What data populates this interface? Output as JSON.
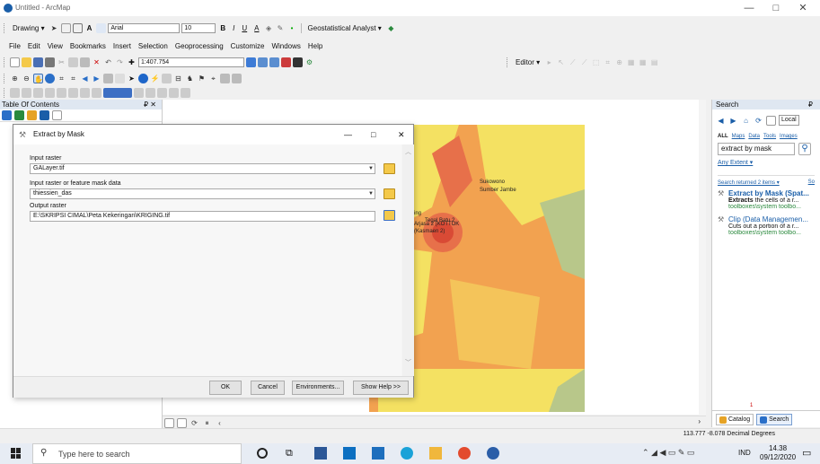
{
  "window": {
    "title": "Untitled - ArcMap",
    "minimize": "—",
    "maximize": "□",
    "close": "✕"
  },
  "drawing_toolbar": {
    "drawing_label": "Drawing ▾",
    "font_name": "Arial",
    "font_size": "10",
    "bold": "B",
    "italic": "I",
    "underline": "U",
    "letter_a": "A",
    "geostat_label": "Geostatistical Analyst ▾"
  },
  "menu": [
    "File",
    "Edit",
    "View",
    "Bookmarks",
    "Insert",
    "Selection",
    "Geoprocessing",
    "Customize",
    "Windows",
    "Help"
  ],
  "standard_toolbar": {
    "scale": "1:407.754",
    "editor_label": "Editor ▾"
  },
  "toc": {
    "title": "Table Of Contents",
    "pin": "₽ ✕"
  },
  "dialog": {
    "title": "Extract by Mask",
    "input_raster_label": "Input raster",
    "input_raster_value": "GALayer.tif",
    "mask_label": "Input raster or feature mask data",
    "mask_value": "thiessien_das",
    "output_label": "Output raster",
    "output_value": "E:\\SKRIPSI CIMAL\\Peta Kekeringan\\KRIGING.tif",
    "ok": "OK",
    "cancel": "Cancel",
    "environments": "Environments...",
    "show_help": "Show Help >>",
    "minimize": "—",
    "maximize": "□",
    "close": "✕"
  },
  "map": {
    "labels": [
      "Sukowono",
      "Sumber Jambe",
      "Tegal Batu 2",
      "Arjasa 2 (KOTTOK",
      "(Kasmaen 2)",
      "ring"
    ]
  },
  "search_pane": {
    "title": "Search",
    "pin": "₽",
    "local_label": "Local",
    "filters": [
      "ALL",
      "Maps",
      "Data",
      "Tools",
      "Images"
    ],
    "query": "extract by mask",
    "any_extent": "Any Extent ▾",
    "results_summary": "Search returned 2 items ▾",
    "sort": "So",
    "results": [
      {
        "title": "Extract by Mask (Spat...",
        "desc_bold": "Extracts",
        "desc": " the cells of a r...",
        "path": "toolboxes\\system toolbo..."
      },
      {
        "title": "Clip (Data Managemen...",
        "desc": "Cuts out a portion of a r...",
        "path": "toolboxes\\system toolbo..."
      }
    ],
    "catalog_tab": "Catalog",
    "search_tab": "Search",
    "badge": "1"
  },
  "status": {
    "coordinates": "113.777  -8.078 Decimal Degrees"
  },
  "taskbar": {
    "search_placeholder": "Type here to search",
    "time": "14.38",
    "date": "09/12/2020",
    "lang": "IND"
  },
  "colors": {
    "accent": "#1a5ea8",
    "map_orange": "#f2a250",
    "map_yellow": "#f4e162",
    "map_red": "#d94a35",
    "map_green": "#b8c78a"
  }
}
